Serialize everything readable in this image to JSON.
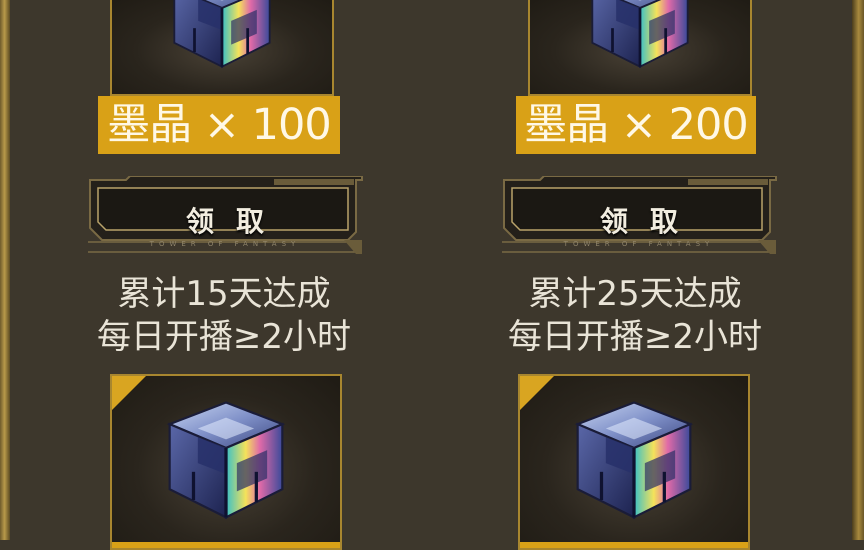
{
  "rewards": [
    {
      "item": "墨晶 × 100",
      "button_label": "领取",
      "button_sub": "TOWER OF FANTASY",
      "condition_line1": "累计15天达成",
      "condition_line2": "每日开播≥2小时"
    },
    {
      "item": "墨晶 × 200",
      "button_label": "领取",
      "button_sub": "TOWER OF FANTASY",
      "condition_line1": "累计25天达成",
      "condition_line2": "每日开播≥2小时"
    }
  ],
  "icons": {
    "reward_item": "crystal-cube-icon",
    "corner_flag": "corner-badge-icon"
  },
  "colors": {
    "accent_gold": "#d9a117",
    "panel_bg": "#3d372c",
    "text": "#e9e4d7"
  }
}
